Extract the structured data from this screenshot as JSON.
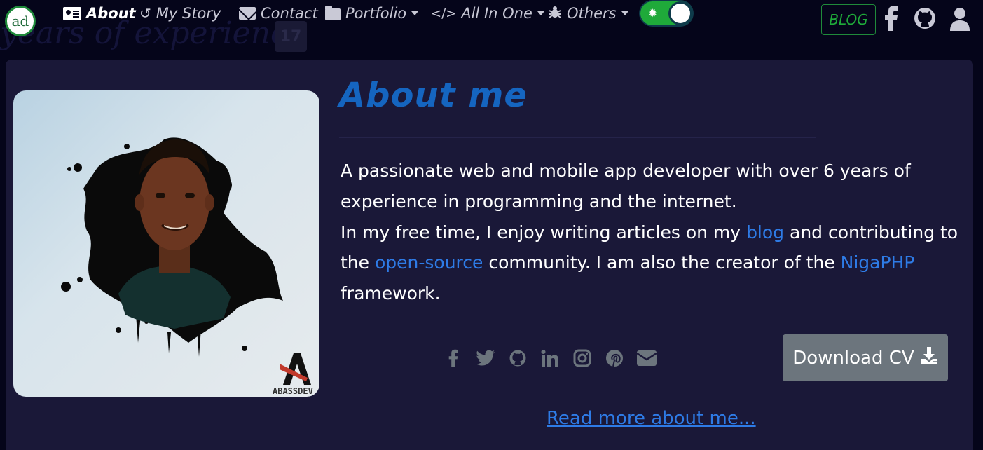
{
  "ghost": {
    "text": "years of experience",
    "badge": "17"
  },
  "logo": {
    "text": "ad"
  },
  "nav": {
    "items": [
      {
        "label": "About",
        "icon": "id-card-icon"
      },
      {
        "label": "My Story",
        "icon": "history-icon"
      },
      {
        "label": "Contact",
        "icon": "envelope-icon"
      },
      {
        "label": "Portfolio",
        "icon": "folder-icon"
      },
      {
        "label": "All In One",
        "icon": "code-icon"
      },
      {
        "label": "Others",
        "icon": "bug-icon"
      }
    ],
    "blog_label": "BLOG",
    "theme_toggle": {
      "state": "on",
      "icon": "sun-icon",
      "color": "#1faa3a"
    }
  },
  "about": {
    "title": "About me",
    "bio": {
      "line1": "A passionate web and mobile app developer with over 6 years of experience in programming and the internet.",
      "line2_before": "In my free time, I enjoy writing articles on my ",
      "blog_link": "blog",
      "line2_mid": " and contributing to the ",
      "opensource_link": "open-source",
      "line2_after": " community. I am also the creator of the ",
      "nigaphp_link": "NigaPHP",
      "line2_end": " framework."
    },
    "download_label": "Download CV",
    "read_more": "Read more about me...",
    "photo_watermark": "ABASSDEV"
  },
  "socials": [
    "facebook-icon",
    "twitter-icon",
    "github-icon",
    "linkedin-icon",
    "instagram-icon",
    "pinterest-icon",
    "envelope-icon"
  ],
  "colors": {
    "accent": "#1565c0",
    "link": "#2e7be6",
    "brand_green": "#1faa3a",
    "card_bg": "#1a1838",
    "page_bg": "#05051a"
  }
}
